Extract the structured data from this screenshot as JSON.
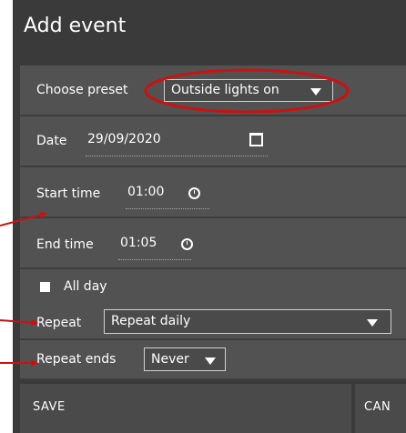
{
  "dialog": {
    "title": "Add event"
  },
  "preset": {
    "label": "Choose preset",
    "value": "Outside lights on"
  },
  "date": {
    "label": "Date",
    "value": "29/09/2020"
  },
  "start_time": {
    "label": "Start time",
    "value": "01:00"
  },
  "end_time": {
    "label": "End time",
    "value": "01:05"
  },
  "all_day": {
    "label": "All day",
    "checked": false
  },
  "repeat": {
    "label": "Repeat",
    "value": "Repeat daily"
  },
  "repeat_ends": {
    "label": "Repeat ends",
    "value": "Never"
  },
  "buttons": {
    "save": "SAVE",
    "cancel": "CAN"
  },
  "annotations": {
    "color": "#cc1111"
  },
  "icons": {
    "calendar": "calendar-icon",
    "clock": "clock-icon",
    "dropdown": "caret-down-icon",
    "checkbox": "checkbox-icon"
  }
}
